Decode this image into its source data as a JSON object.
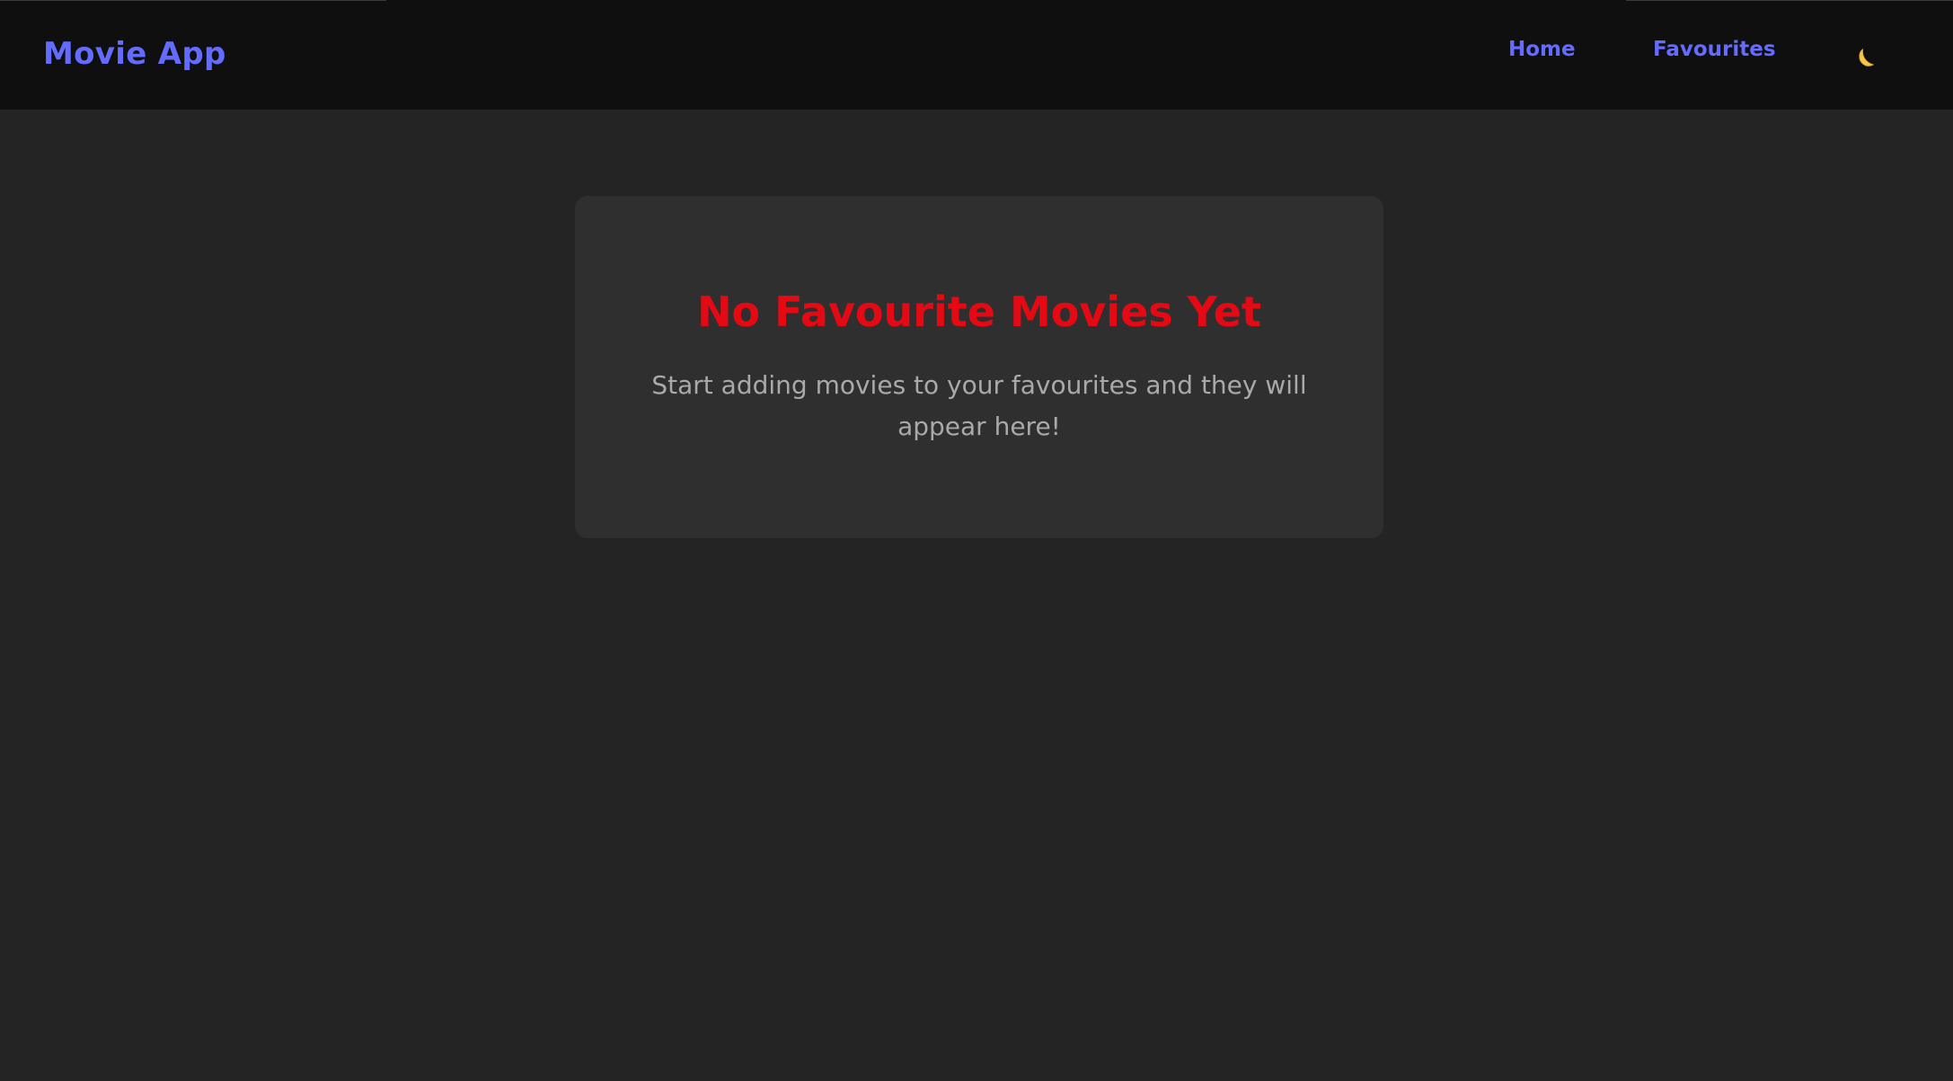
{
  "header": {
    "brand": "Movie App",
    "nav": {
      "home_label": "Home",
      "favourites_label": "Favourites"
    },
    "theme_toggle_icon": "moon-icon"
  },
  "main": {
    "empty_state": {
      "title": "No Favourite Movies Yet",
      "message": "Start adding movies to your favourites and they will appear here!"
    }
  },
  "colors": {
    "accent": "#646cff",
    "title_red": "#e50914",
    "page_bg": "#242424",
    "nav_bg": "#0f0f0f",
    "card_bg": "#2f2f2f",
    "moon": "#f5c84c"
  }
}
